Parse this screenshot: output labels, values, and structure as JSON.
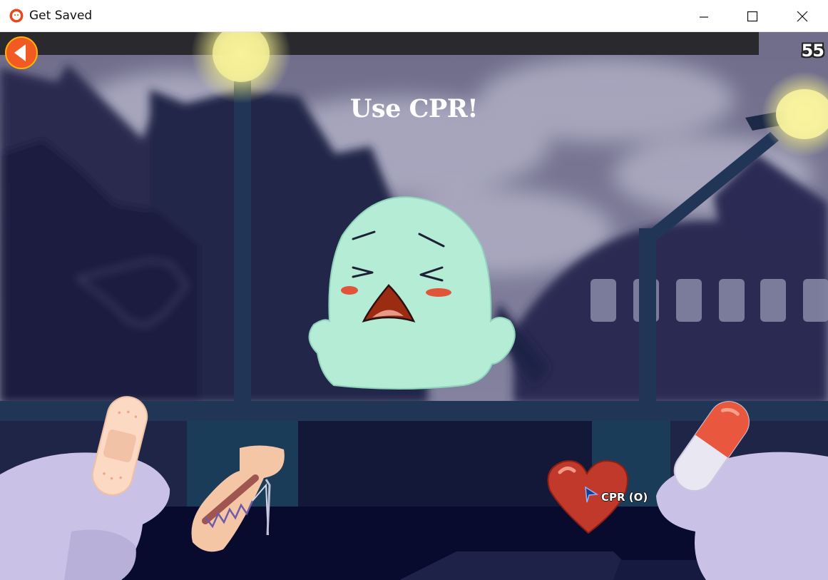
{
  "window": {
    "title": "Get Saved",
    "controls": [
      "minimize",
      "maximize",
      "close"
    ]
  },
  "game": {
    "timer": "55",
    "instruction": "Use CPR!",
    "back_button_icon": "back-arrow-icon",
    "tools": [
      {
        "name": "bandage",
        "icon": "bandage-icon"
      },
      {
        "name": "stitches",
        "icon": "stitched-arm-icon"
      },
      {
        "name": "cpr",
        "icon": "heart-icon",
        "label": "CPR (O)"
      },
      {
        "name": "pill",
        "icon": "pill-icon"
      }
    ]
  },
  "colors": {
    "accent_orange": "#f15a22",
    "ghost": "#b4ecd6",
    "heart": "#c0392b",
    "night": "#0a0b33"
  }
}
